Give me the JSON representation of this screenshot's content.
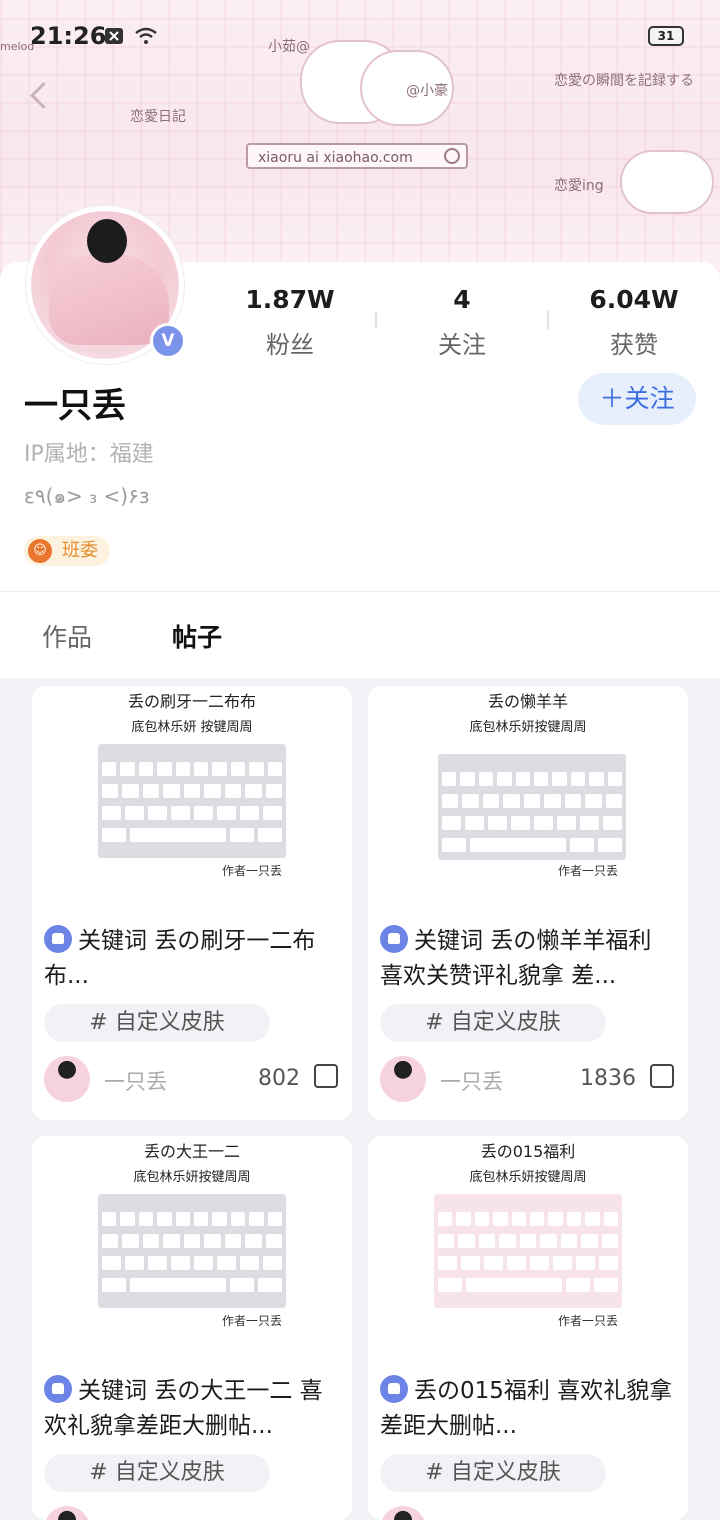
{
  "status_bar": {
    "time": "21:26",
    "battery": "31"
  },
  "banner": {
    "tags": [
      "小茹@",
      "@小豪",
      "恋愛日記",
      "恋愛の瞬間を記録する",
      "恋愛ing",
      "melod"
    ],
    "search_text": "xiaoru ai xiaohao.com"
  },
  "profile": {
    "name": "一只丢",
    "verified_badge": "V",
    "ip": "IP属地：福建",
    "bio": "ε٩(๑> ₃ <)۶з",
    "tag": "班委",
    "follow_button": "＋关注",
    "stats": [
      {
        "value": "1.87W",
        "label": "粉丝"
      },
      {
        "value": "4",
        "label": "关注"
      },
      {
        "value": "6.04W",
        "label": "获赞"
      }
    ]
  },
  "tabs": [
    {
      "label": "作品"
    },
    {
      "label": "帖子"
    }
  ],
  "posts": [
    {
      "thumb_title": "丢の刷牙一二布布",
      "thumb_subtitle": "底包林乐妍 按键周周",
      "thumb_author": "作者一只丢",
      "title_prefix": "关键词 ",
      "title": "丢の刷牙一二布布...",
      "topic": "# 自定义皮肤",
      "author": "一只丢",
      "likes": "802"
    },
    {
      "thumb_title": "丢の懒羊羊",
      "thumb_subtitle": "底包林乐妍按键周周",
      "thumb_author": "作者一只丢",
      "title_prefix": "关键词 ",
      "title": "丢の懒羊羊福利 喜欢关赞评礼貌拿 差...",
      "topic": "# 自定义皮肤",
      "author": "一只丢",
      "likes": "1836"
    },
    {
      "thumb_title": "丢の大王一二",
      "thumb_subtitle": "底包林乐妍按键周周",
      "thumb_author": "作者一只丢",
      "title_prefix": "关键词 ",
      "title": "丢の大王一二 喜欢礼貌拿差距大删帖...",
      "topic": "# 自定义皮肤",
      "author": "",
      "likes": ""
    },
    {
      "thumb_title": "丢の015福利",
      "thumb_subtitle": "底包林乐妍按键周周",
      "thumb_author": "作者一只丢",
      "title_prefix": "",
      "title": "丢の015福利 喜欢礼貌拿差距大删帖...",
      "topic": "# 自定义皮肤",
      "author": "",
      "likes": ""
    }
  ]
}
